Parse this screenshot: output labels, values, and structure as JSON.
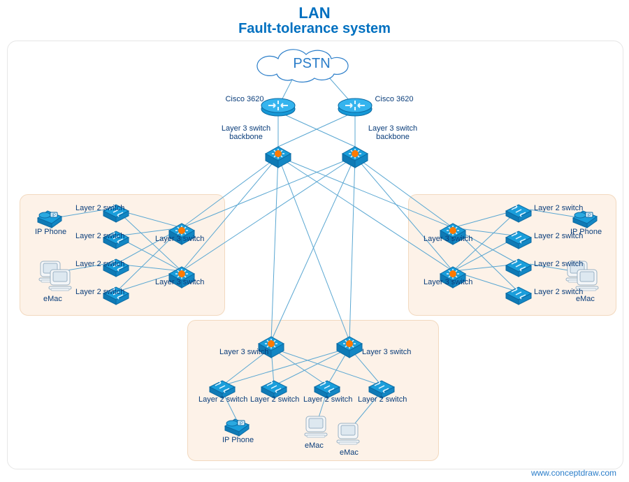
{
  "title": {
    "line1": "LAN",
    "line2": "Fault-tolerance system"
  },
  "cloud_label": "PSTN",
  "credit": "www.conceptdraw.com",
  "labels": {
    "cisco": "Cisco 3620",
    "l3back": "Layer 3 switch\nbackbone",
    "l3": "Layer 3 switch",
    "l2": "Layer 2 switch",
    "ipphone": "IP Phone",
    "emac": "eMac"
  }
}
